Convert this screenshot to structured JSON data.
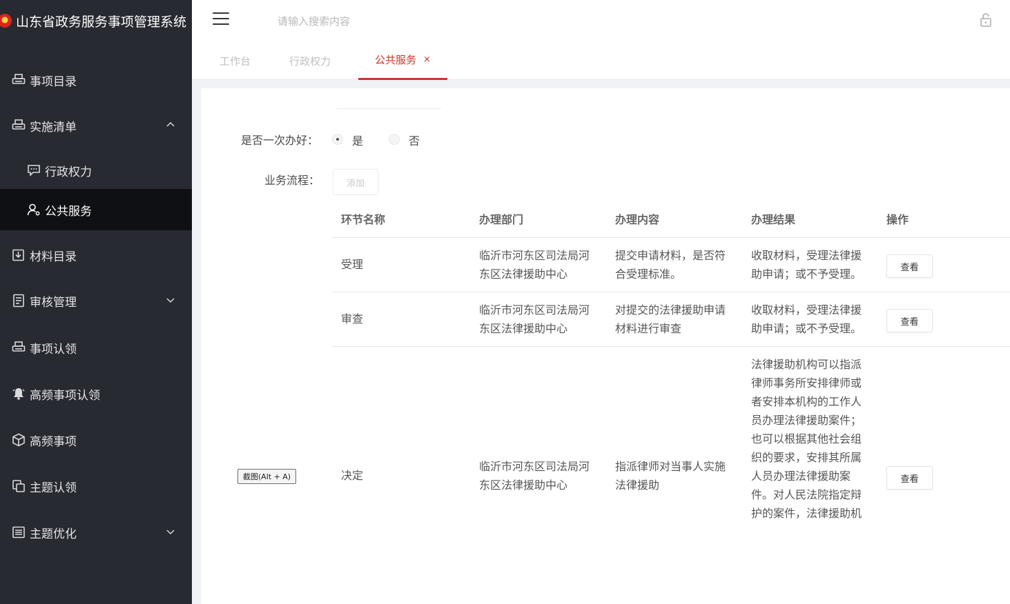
{
  "app": {
    "title": "山东省政务服务事项管理系统"
  },
  "sidebar": {
    "items": [
      {
        "label": "事项目录",
        "icon": "printer-icon"
      },
      {
        "label": "实施清单",
        "icon": "printer-icon",
        "expanded": true
      },
      {
        "label": "行政权力",
        "icon": "chat-icon"
      },
      {
        "label": "公共服务",
        "icon": "user-icon",
        "active": true
      },
      {
        "label": "材料目录",
        "icon": "download-icon"
      },
      {
        "label": "审核管理",
        "icon": "document-icon",
        "expanded": false
      },
      {
        "label": "事项认领",
        "icon": "printer-icon"
      },
      {
        "label": "高频事项认领",
        "icon": "bell-icon"
      },
      {
        "label": "高频事项",
        "icon": "cube-icon"
      },
      {
        "label": "主题认领",
        "icon": "copy-icon"
      },
      {
        "label": "主题优化",
        "icon": "list-icon",
        "expanded": false
      }
    ]
  },
  "header": {
    "search_placeholder": "请输入搜索内容"
  },
  "tabs": [
    {
      "label": "工作台"
    },
    {
      "label": "行政权力"
    },
    {
      "label": "公共服务",
      "active": true,
      "close": "×"
    }
  ],
  "form": {
    "once_label": "是否一次办好：",
    "once_yes": "是",
    "once_no": "否",
    "once_value": "是",
    "process_label": "业务流程：",
    "add_label": "添加"
  },
  "table": {
    "headers": [
      "环节名称",
      "办理部门",
      "办理内容",
      "办理结果",
      "操作"
    ],
    "rows": [
      {
        "step": "受理",
        "dept": "临沂市河东区司法局河东区法律援助中心",
        "content": "提交申请材料，是否符合受理标准。",
        "result": "收取材料，受理法律援助申请；或不予受理。",
        "action": "查看"
      },
      {
        "step": "审查",
        "dept": "临沂市河东区司法局河东区法律援助中心",
        "content": "对提交的法律援助申请材料进行审查",
        "result": "收取材料，受理法律援助申请；或不予受理。",
        "action": "查看"
      },
      {
        "step": "决定",
        "dept": "临沂市河东区司法局河东区法律援助中心",
        "content": "指派律师对当事人实施法律援助",
        "result": "法律援助机构可以指派律师事务所安排律师或者安排本机构的工作人员办理法律援助案件；也可以根据其他社会组织的要求，安排其所属人员办理法律援助案件。对人民法院指定辩护的案件，法律援助机",
        "action": "查看"
      }
    ]
  },
  "screenshot_tip": "截图(Alt + A)",
  "colors": {
    "sidebar_bg": "#282a32",
    "sidebar_active_bg": "#0f1014",
    "accent": "#c7352a"
  }
}
